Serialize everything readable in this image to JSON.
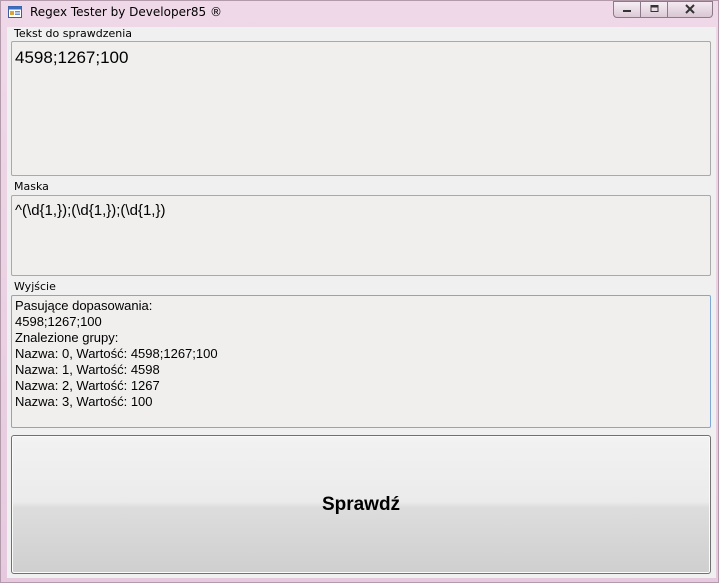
{
  "window": {
    "title": "Regex Tester by Developer85 ®"
  },
  "input": {
    "label": "Tekst do sprawdzenia",
    "value": "4598;1267;100"
  },
  "mask": {
    "label": "Maska",
    "value": "^(\\d{1,});(\\d{1,});(\\d{1,})"
  },
  "output": {
    "label": "Wyjście",
    "lines": [
      "Pasujące dopasowania:",
      "4598;1267;100",
      "Znalezione grupy:",
      "Nazwa: 0, Wartość: 4598;1267;100",
      "Nazwa: 1, Wartość: 4598",
      "Nazwa: 2, Wartość: 1267",
      "Nazwa: 3, Wartość: 100"
    ]
  },
  "check_button": {
    "label": "Sprawdź"
  },
  "icons": {
    "app": "app-window-icon",
    "minimize": "minimize-icon",
    "maximize": "maximize-icon",
    "close": "close-icon"
  },
  "colors": {
    "titlebar": "#e9cfe2",
    "client_bg": "#f0f0f0",
    "focus_border": "#7fa8d6"
  }
}
